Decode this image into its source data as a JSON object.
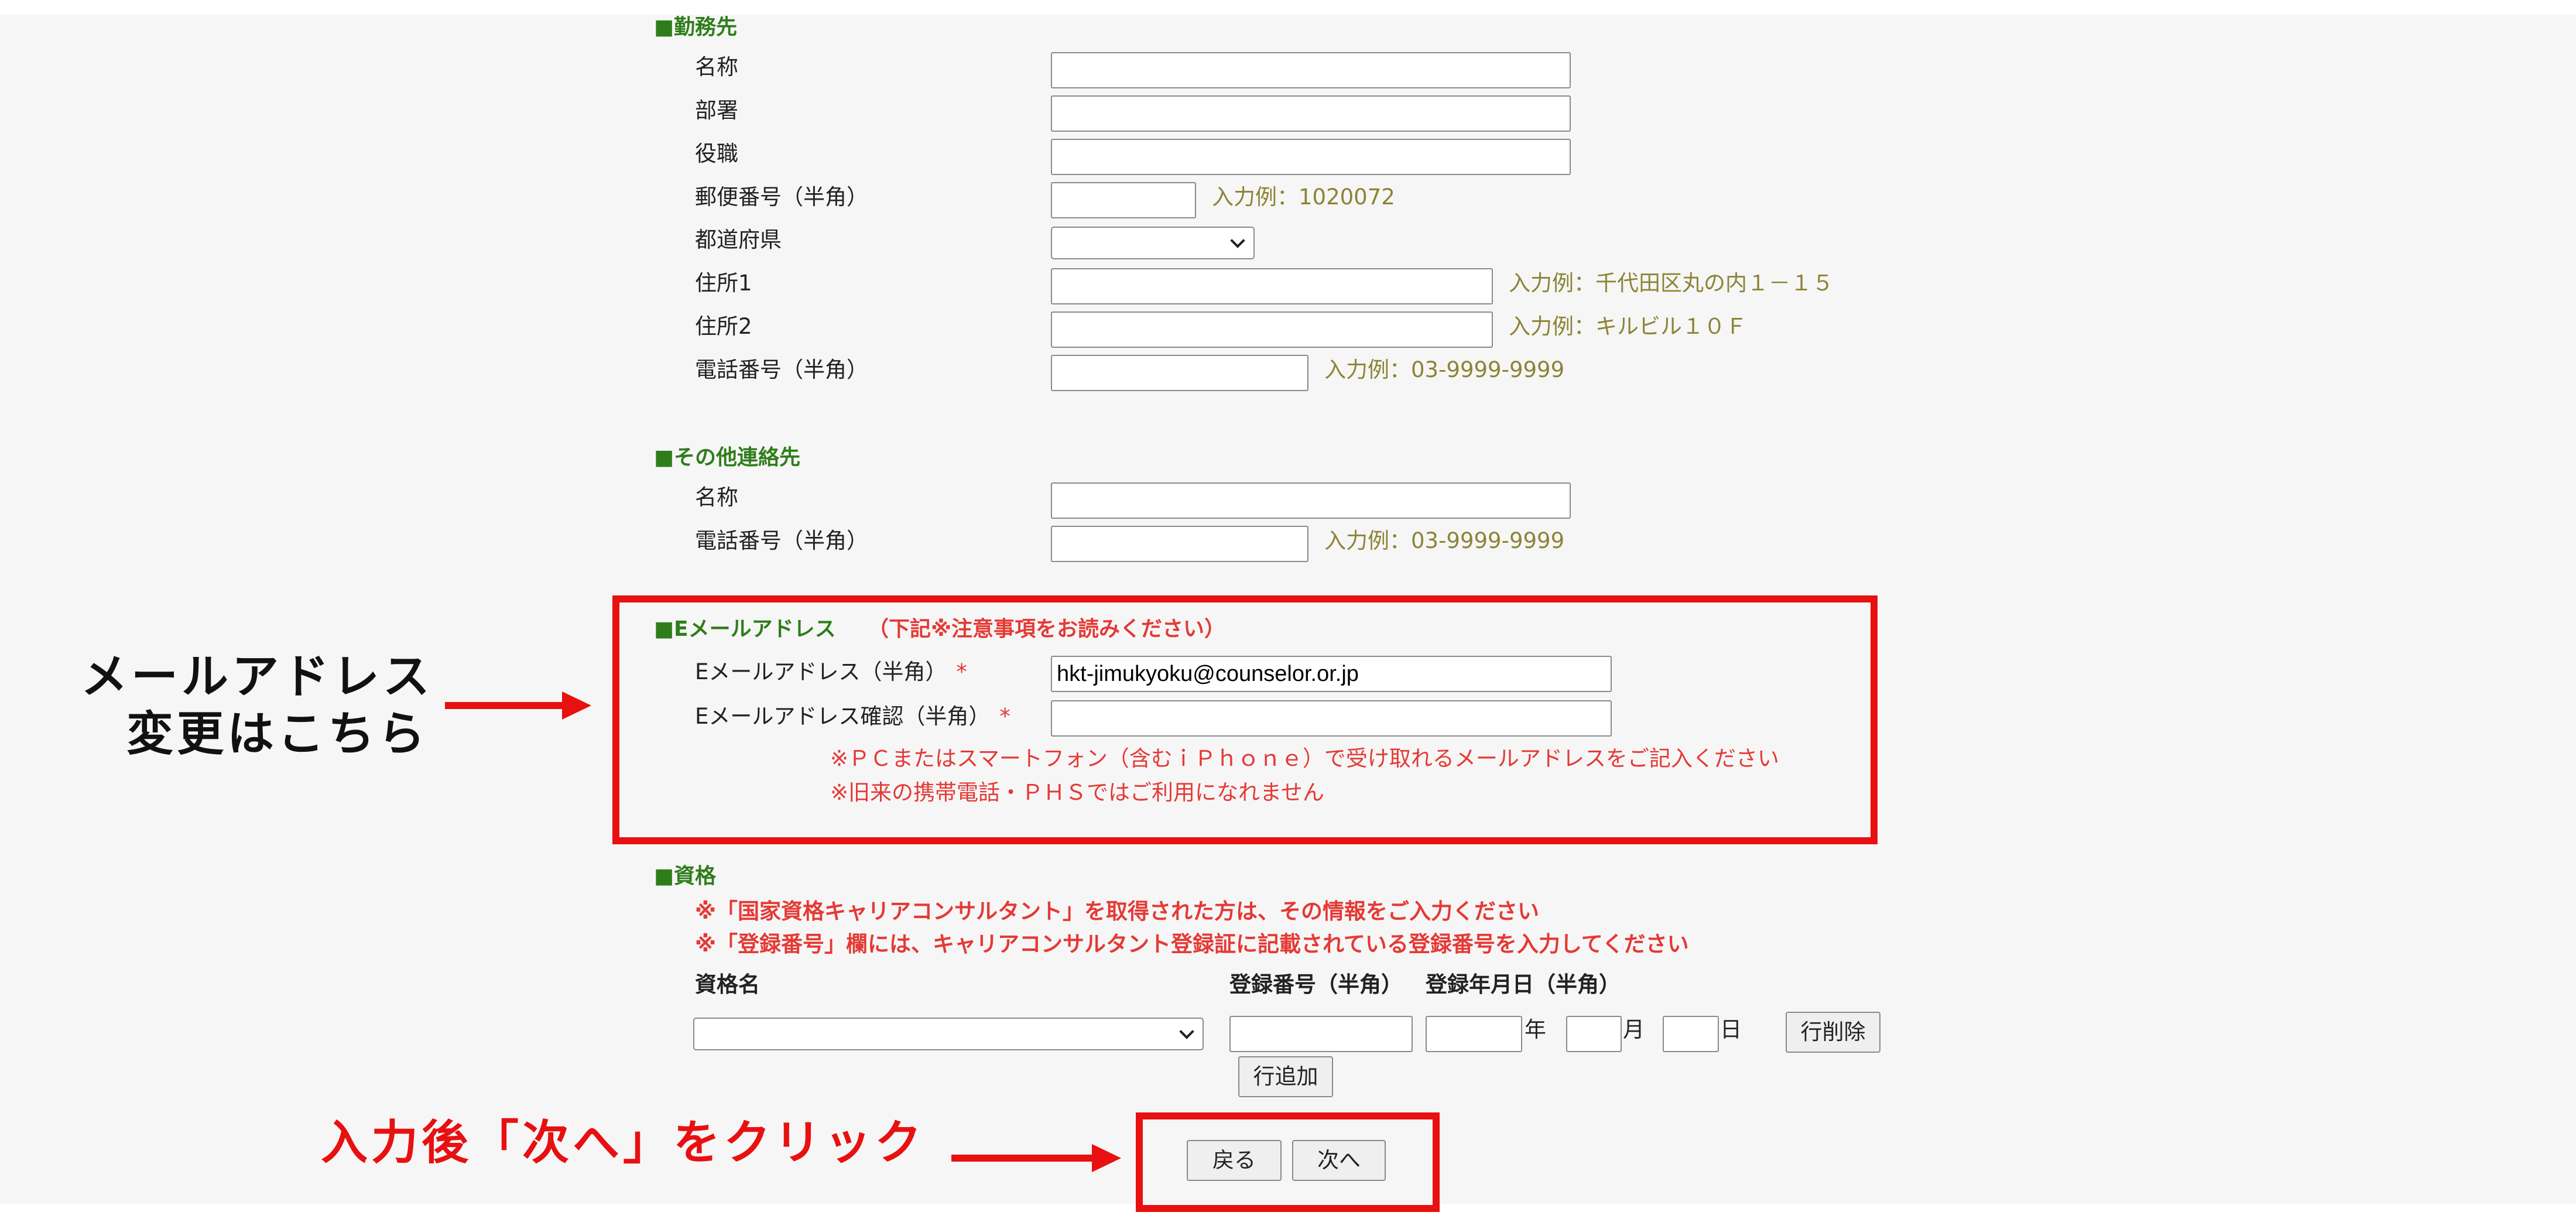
{
  "workplace": {
    "title": "■勤務先",
    "name_label": "名称",
    "dept_label": "部署",
    "position_label": "役職",
    "postal_label": "郵便番号（半角）",
    "postal_hint": "入力例：1020072",
    "pref_label": "都道府県",
    "addr1_label": "住所1",
    "addr1_hint": "入力例：千代田区丸の内１－１５",
    "addr2_label": "住所2",
    "addr2_hint": "入力例：キルビル１０Ｆ",
    "phone_label": "電話番号（半角）",
    "phone_hint": "入力例：03-9999-9999"
  },
  "other_contact": {
    "title": "■その他連絡先",
    "name_label": "名称",
    "phone_label": "電話番号（半角）",
    "phone_hint": "入力例：03-9999-9999"
  },
  "email": {
    "title": "■Eメールアドレス",
    "note_title": "（下記※注意事項をお読みください）",
    "email_label": "Eメールアドレス（半角）",
    "email_value": "hkt-jimukyoku@counselor.or.jp",
    "confirm_label": "Eメールアドレス確認（半角）",
    "required_mark": "*",
    "note1": "※ＰＣまたはスマートフォン（含むｉＰｈｏｎｅ）で受け取れるメールアドレスをご記入ください",
    "note2": "※旧来の携帯電話・ＰＨＳではご利用になれません"
  },
  "qualification": {
    "title": "■資格",
    "note1": "※「国家資格キャリアコンサルタント」を取得された方は、その情報をご入力ください",
    "note2": "※「登録番号」欄には、キャリアコンサルタント登録証に記載されている登録番号を入力してください",
    "col_name": "資格名",
    "col_regno": "登録番号（半角）",
    "col_regdate": "登録年月日（半角）",
    "year_label": "年",
    "month_label": "月",
    "day_label": "日",
    "delete_row_button": "行削除",
    "add_row_button": "行追加"
  },
  "nav": {
    "back_button": "戻る",
    "next_button": "次へ"
  },
  "annotations": {
    "email_callout_line1": "メールアドレス",
    "email_callout_line2": "変更はこちら",
    "next_callout": "入力後「次へ」をクリック"
  },
  "colors": {
    "section_title": "#2e7d1a",
    "hint": "#8c8435",
    "note": "#e53935",
    "annotation_red": "#e81010"
  }
}
